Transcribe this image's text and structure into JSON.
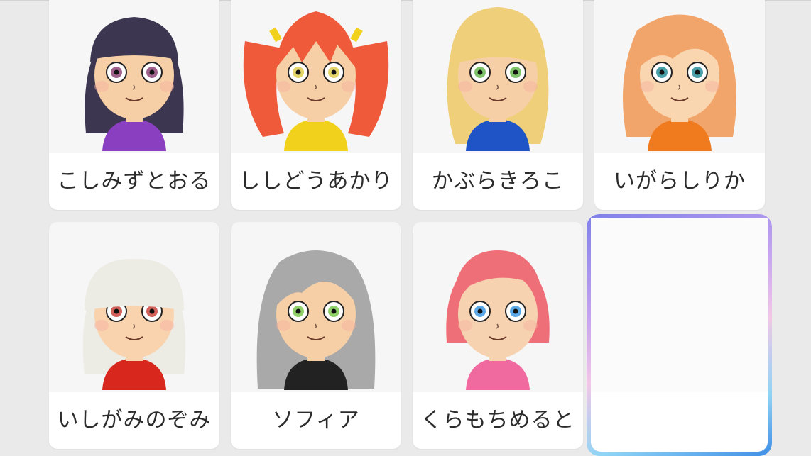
{
  "miis": [
    {
      "name": "こしみずとおる",
      "hair": "#3d3650",
      "shirt": "#8a3fc0",
      "eye": "#a0628c",
      "skin": "#f7cfa6",
      "style": "bob"
    },
    {
      "name": "ししどうあかり",
      "hair": "#ef5a3a",
      "shirt": "#f2d11c",
      "eye": "#e4d56a",
      "skin": "#f7cfa6",
      "style": "twintails"
    },
    {
      "name": "かぶらきろこ",
      "hair": "#f0cf7a",
      "shirt": "#1e54c6",
      "eye": "#7fc46a",
      "skin": "#f7cfa6",
      "style": "wavy"
    },
    {
      "name": "いがらしりか",
      "hair": "#f2a56b",
      "shirt": "#f07a1e",
      "eye": "#4aa0a8",
      "skin": "#f9d6b0",
      "style": "long"
    },
    {
      "name": "いしがみのぞみ",
      "hair": "#ecebe4",
      "shirt": "#d8281e",
      "eye": "#d06058",
      "skin": "#f9d3ae",
      "style": "helmet"
    },
    {
      "name": "ソフィア",
      "hair": "#a9a9a9",
      "shirt": "#222222",
      "eye": "#8fd069",
      "skin": "#f7cfa6",
      "style": "longgray"
    },
    {
      "name": "くらもちめると",
      "hair": "#ef6f78",
      "shirt": "#f06aa0",
      "eye": "#5aa8e8",
      "skin": "#f7d2b0",
      "style": "short"
    }
  ],
  "selected_slot": {
    "name": ""
  },
  "colors": {
    "background": "#eaeaea",
    "card": "#ffffff",
    "portrait_bg": "#f6f6f6",
    "selection_gradient": [
      "#7f7fe8",
      "#f2c7e7",
      "#3f8de6"
    ]
  }
}
